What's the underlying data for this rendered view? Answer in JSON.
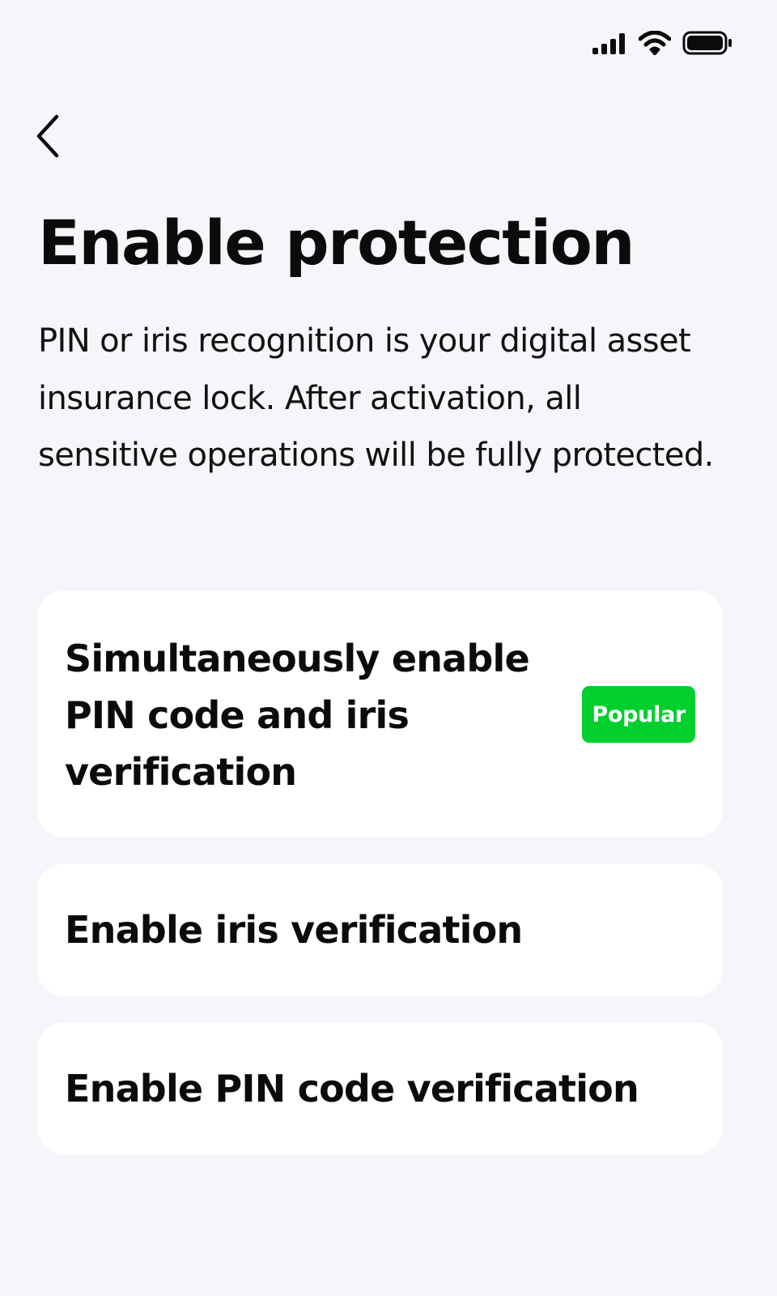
{
  "status_bar": {
    "icons": [
      "cellular-signal-icon",
      "wifi-icon",
      "battery-icon"
    ]
  },
  "header": {
    "back_icon": "chevron-left-icon",
    "title": "Enable protection",
    "description": "PIN or iris recognition is your digital asset insurance lock. After activation, all sensitive operations will be fully protected."
  },
  "options": [
    {
      "label": "Simultaneously enable PIN code and iris verification",
      "badge": "Popular",
      "badge_color": "#00cf2d"
    },
    {
      "label": "Enable iris verification"
    },
    {
      "label": "Enable PIN code verification"
    }
  ],
  "colors": {
    "background": "#f5f6fa",
    "card": "#ffffff",
    "text": "#0b0b0b",
    "accent_badge": "#00cf2d"
  }
}
